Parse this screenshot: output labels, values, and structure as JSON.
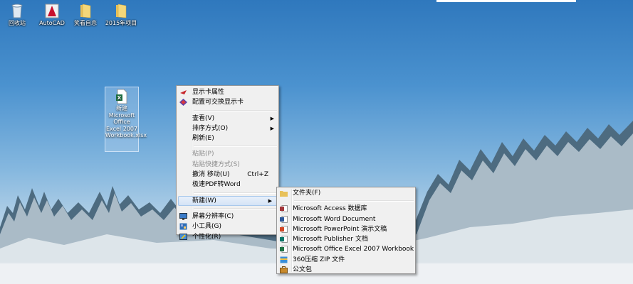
{
  "desktop": {
    "icons": [
      {
        "label": "回收站",
        "icon": "recycle-bin-icon"
      },
      {
        "label": "AutoCAD",
        "icon": "autocad-icon"
      },
      {
        "label": "笑看自恋",
        "icon": "folder-icon"
      },
      {
        "label": "2015年项目",
        "icon": "folder-icon"
      }
    ],
    "selected_file": {
      "label": "新建 Microsoft Office Excel 2007 Workbook.xlsx",
      "icon": "excel-file-icon"
    }
  },
  "context_menu": {
    "items": [
      {
        "label": "显示卡属性"
      },
      {
        "label": "配置可交换显示卡"
      },
      {
        "label": "查看(V)"
      },
      {
        "label": "排序方式(O)"
      },
      {
        "label": "刷新(E)"
      },
      {
        "label": "粘贴(P)"
      },
      {
        "label": "粘贴快捷方式(S)"
      },
      {
        "label": "撤消 移动(U)",
        "shortcut": "Ctrl+Z"
      },
      {
        "label": "极速PDF转Word"
      },
      {
        "label": "新建(W)"
      },
      {
        "label": "屏幕分辨率(C)"
      },
      {
        "label": "小工具(G)"
      },
      {
        "label": "个性化(R)"
      }
    ]
  },
  "submenu_new": {
    "items": [
      {
        "label": "文件夹(F)"
      },
      {
        "label": "Microsoft Access 数据库"
      },
      {
        "label": "Microsoft Word Document"
      },
      {
        "label": "Microsoft PowerPoint 演示文稿"
      },
      {
        "label": "Microsoft Publisher 文档"
      },
      {
        "label": "Microsoft Office Excel 2007 Workbook"
      },
      {
        "label": "360压缩 ZIP 文件"
      },
      {
        "label": "公文包"
      }
    ]
  },
  "colors": {
    "access": "#a4373a",
    "word": "#2b579a",
    "powerpoint": "#d24726",
    "publisher": "#077568",
    "excel": "#217346"
  }
}
